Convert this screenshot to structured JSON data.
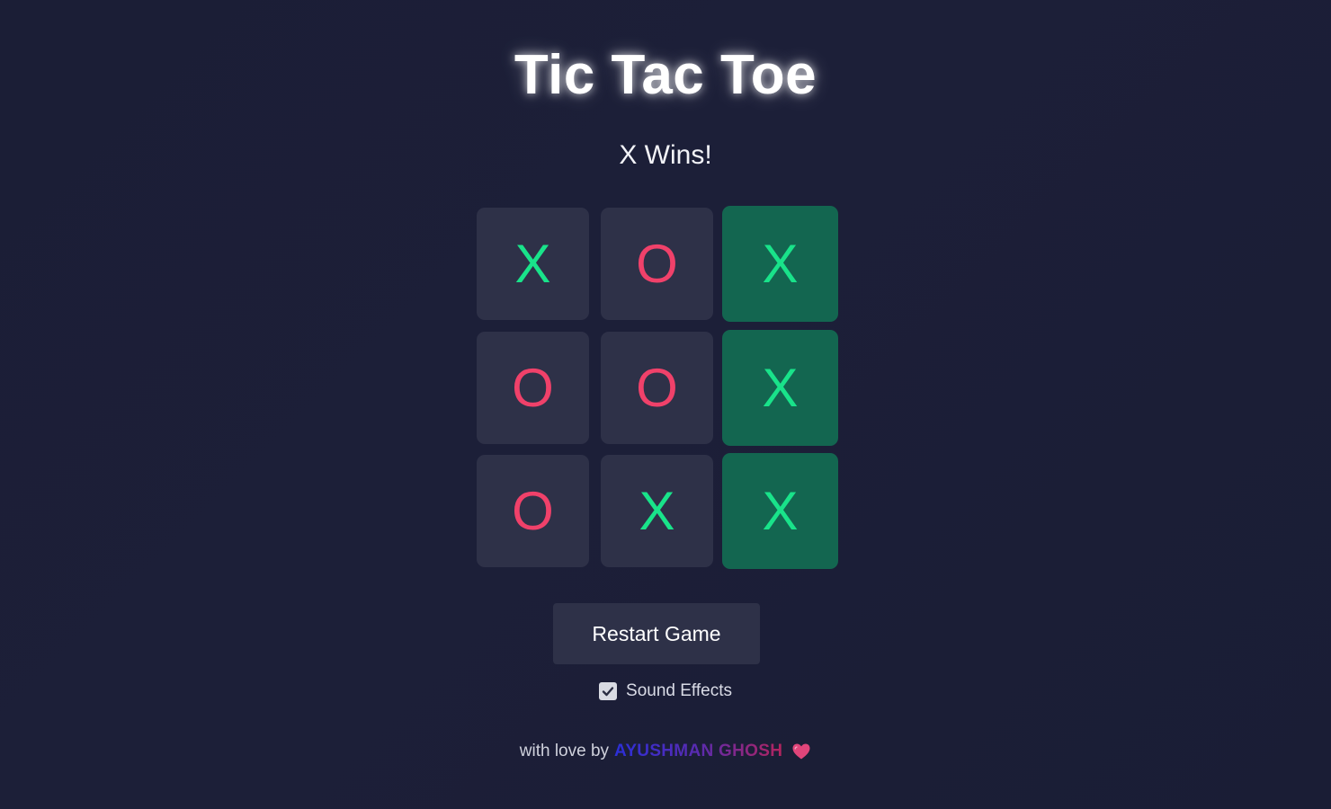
{
  "header": {
    "title": "Tic Tac Toe"
  },
  "game": {
    "status": "X Wins!",
    "winning_cells": [
      2,
      5,
      8
    ],
    "board": [
      "X",
      "O",
      "X",
      "O",
      "O",
      "X",
      "O",
      "X",
      "X"
    ]
  },
  "controls": {
    "restart_label": "Restart Game",
    "sound_label": "Sound Effects",
    "sound_enabled": true
  },
  "footer": {
    "prefix": "with love by",
    "author": "AYUSHMAN GHOSH",
    "icon": "heart-icon"
  },
  "colors": {
    "background": "#1b1e36",
    "cell": "#2e3148",
    "win_cell": "#136650",
    "x_mark": "#19e38a",
    "o_mark": "#f0416a"
  }
}
